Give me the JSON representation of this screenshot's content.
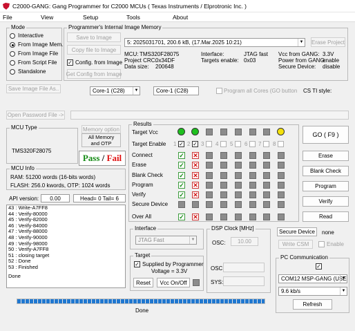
{
  "window": {
    "title": "C2000-GANG:  Gang Programmer for C2000  MCUs ( Texas Instruments / Elprotronic Inc. )"
  },
  "menu": [
    "File",
    "View",
    "Setup",
    "Tools",
    "About"
  ],
  "mode": {
    "title": "Mode",
    "options": [
      "Interactive",
      "From Image Mem.",
      "From Image File",
      "From Script File",
      "Standalone"
    ],
    "selected_index": 1,
    "save_image_button": "Save Image File As.."
  },
  "image_memory": {
    "title": "Programmer's Internal Image Memory",
    "save_to_image": "Save to Image",
    "copy_file_to_image": "Copy file to Image",
    "config_from_image_label": "Config. from Image",
    "config_from_image_checked": "✓",
    "get_config_button": "Get Config from Image",
    "selected_image": "5: 2025031701, 200.6 kB,  (17.Mar.2025  10:21)",
    "erase_project": "Erase Project",
    "info": {
      "mcu_label": "MCU:",
      "mcu_value": "TMS320F28075",
      "crc_label": "Project CRC:",
      "crc_value": "0x34DF",
      "size_label": "Data size:",
      "size_value": "200648",
      "interface_label": "Interface:",
      "interface_value": "JTAG fast",
      "targets_label": "Targets enable:",
      "targets_value": "0x03",
      "vcc_label": "Vcc from GANG:",
      "vcc_value": "3.3V",
      "power_label": "Power from GANG:",
      "power_value": "enable",
      "secure_label": "Secure Device:",
      "secure_value": "disable"
    }
  },
  "core": {
    "select_value": "Core-1 (C28)",
    "field_value": "Core-1 (C28)",
    "program_all_label": "Program all Cores (GO button",
    "cs_ti_style_label": "CS TI style:"
  },
  "password": {
    "button": "Open Password File ->",
    "value": ""
  },
  "mcu_type": {
    "title": "MCU Type",
    "value": "TMS320F28075"
  },
  "memory_option": {
    "button": "Memory option",
    "value_line1": "All Memory",
    "value_line2": "and OTP"
  },
  "pass_fail": {
    "pass": "Pass",
    "sep": " / ",
    "fail": "Fail"
  },
  "mcu_info": {
    "title": "MCU Info",
    "ram": "RAM: 51200 words (16-bits words)",
    "flash": "FLASH: 256.0 kwords,  OTP: 1024 words"
  },
  "api": {
    "label": "API version:",
    "value": "0.00",
    "head": "Head= 0  Tail= 6"
  },
  "log": [
    "43 : Write-A7FF8",
    "44 : Verify-80000",
    "45 : Verify-82000",
    "46 : Verify-84000",
    "47 : Verify-88000",
    "48 : Verify-90000",
    "49 : Verify-98000",
    "50 : Verify-A7FF8",
    "51 : closing target",
    "52 : Done",
    "53 : Finished"
  ],
  "log_status": "Done",
  "results": {
    "title": "Results",
    "rows": [
      "Target Vcc",
      "Target Enable",
      "Connect",
      "Erase",
      "Blank Check",
      "Program",
      "Verify",
      "Secure Device",
      "Over All"
    ],
    "target_numbers": [
      "1",
      "2",
      "3",
      "4",
      "5",
      "6",
      "7",
      "8"
    ],
    "target_enabled": [
      "✓",
      "✓",
      "",
      "",
      "",
      "",
      "",
      ""
    ],
    "vcc_leds": [
      "#1ec01e",
      "#1ec01e",
      "",
      "",
      "",
      "",
      "",
      "#f4e10b"
    ],
    "cells": [
      [
        "ok",
        "fail",
        "grey",
        "grey",
        "grey",
        "grey",
        "grey",
        "grey"
      ],
      [
        "ok",
        "fail",
        "grey",
        "grey",
        "grey",
        "grey",
        "grey",
        "grey"
      ],
      [
        "ok",
        "fail",
        "grey",
        "grey",
        "grey",
        "grey",
        "grey",
        "grey"
      ],
      [
        "ok",
        "fail",
        "grey",
        "grey",
        "grey",
        "grey",
        "grey",
        "grey"
      ],
      [
        "ok",
        "fail",
        "grey",
        "grey",
        "grey",
        "grey",
        "grey",
        "grey"
      ],
      [
        "grey",
        "grey",
        "grey",
        "grey",
        "grey",
        "grey",
        "grey",
        "grey"
      ],
      [
        "ok",
        "fail",
        "grey",
        "grey",
        "grey",
        "grey",
        "grey",
        "grey"
      ]
    ],
    "ok_glyph": "✓",
    "fail_glyph": "✕"
  },
  "actions": {
    "go": "GO   ( F9 )",
    "erase": "Erase",
    "blank_check": "Blank Check",
    "program": "Program",
    "verify": "Verify",
    "read": "Read"
  },
  "interface": {
    "title": "Interface",
    "value": "JTAG Fast"
  },
  "dsp_clock": {
    "title": "DSP Clock [MHz]",
    "osc_label": "OSC:",
    "osc_value": "10.00",
    "osc2_label": "OSC:",
    "sys_label": "SYS:"
  },
  "secure": {
    "button": "Secure Device",
    "value": "none",
    "write_csm": "Write CSM",
    "enable": "Enable"
  },
  "target": {
    "title": "Target",
    "supplied_label": "Supplied by Programmer",
    "supplied_checked": "✓",
    "voltage": "Voltage = 3.3V",
    "reset": "Reset",
    "vcc_onoff": "Vcc On/Off"
  },
  "pc_comm": {
    "title": "PC Communication",
    "checked": "✓",
    "port": "COM12   MSP-GANG (USE",
    "baud": "9.6 kb/s",
    "refresh": "Refresh"
  },
  "progress": {
    "percent": 100,
    "status": "Done"
  },
  "colors": {
    "pass": "#138a13",
    "fail": "#e01010",
    "accent": "#1f77d0"
  }
}
